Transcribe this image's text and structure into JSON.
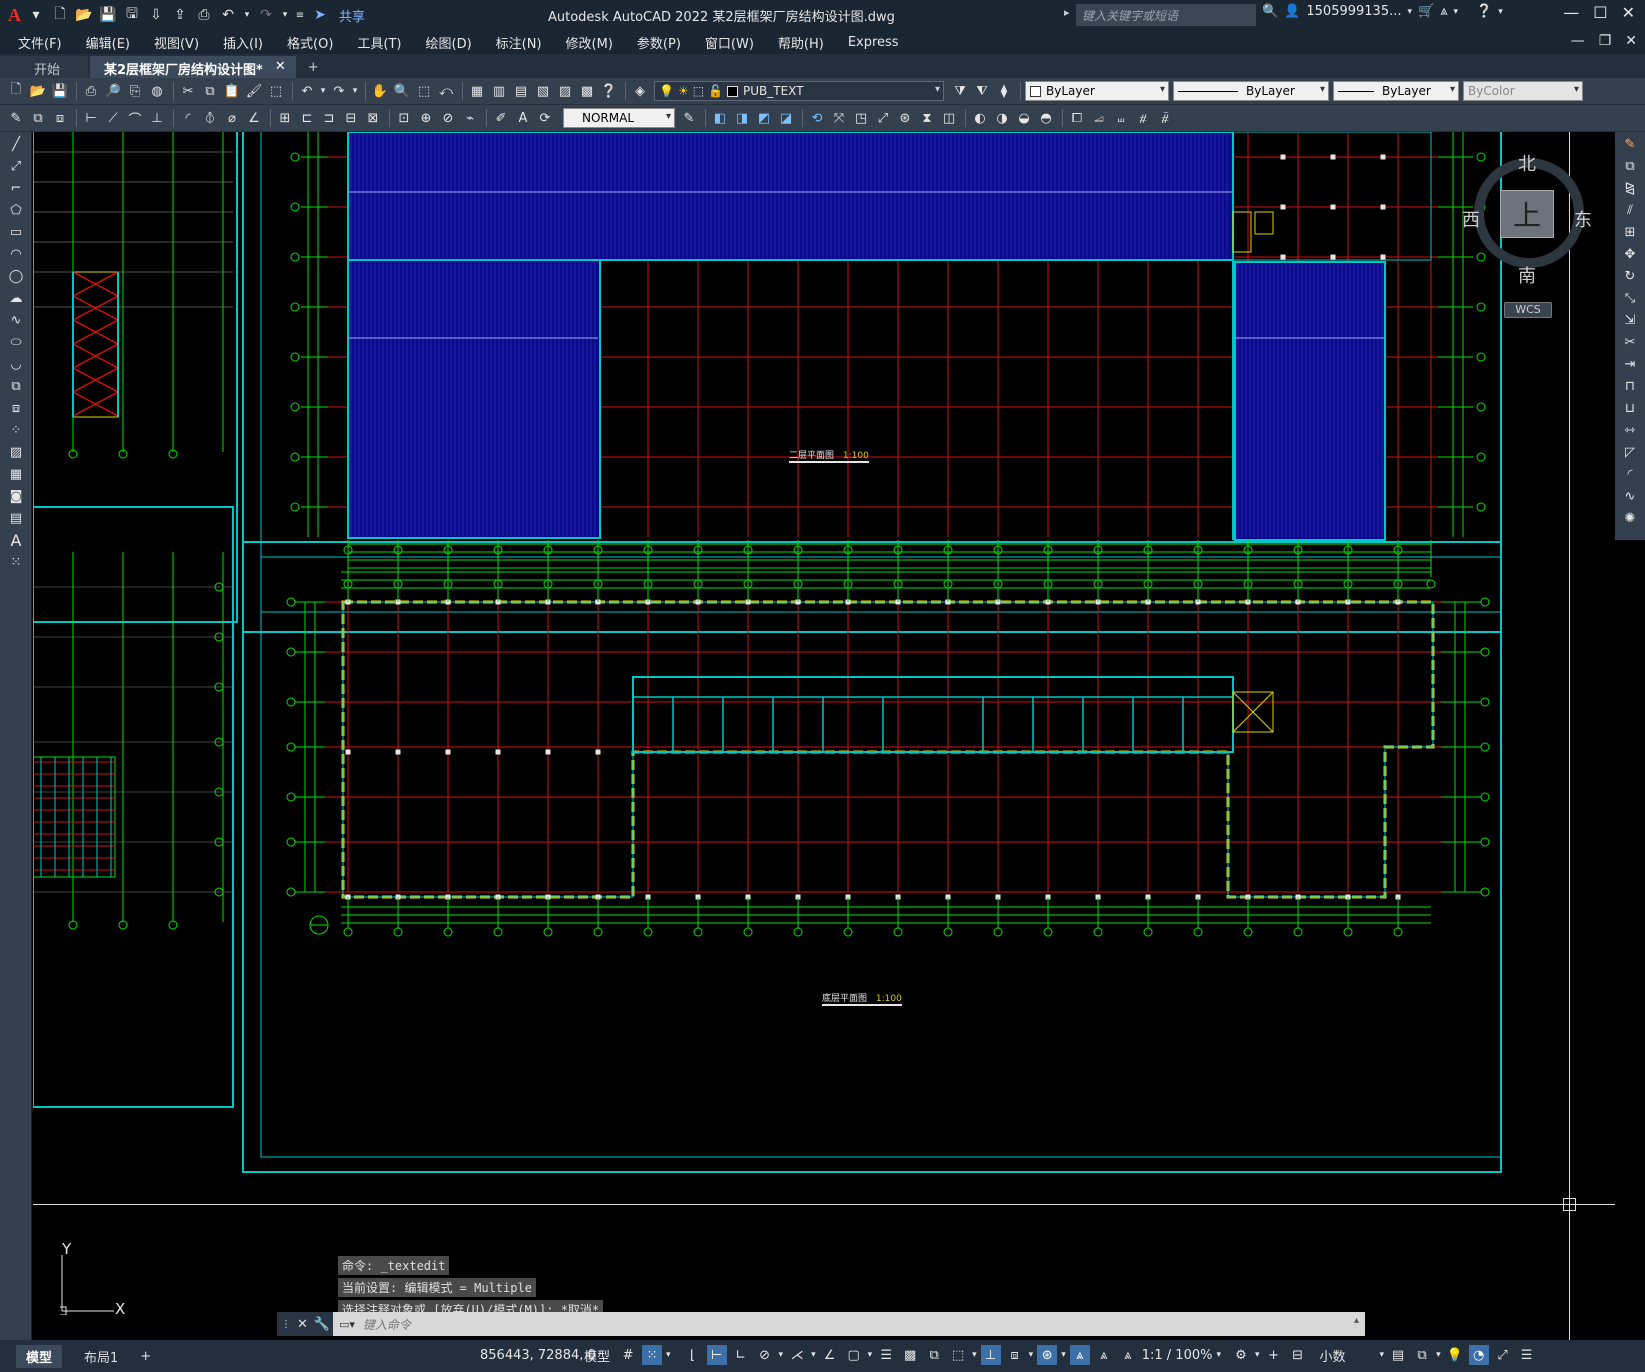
{
  "titlebar": {
    "app_logo": "A",
    "share_label": "共享",
    "title": "Autodesk AutoCAD 2022    某2层框架厂房结构设计图.dwg",
    "search_placeholder": "键入关键字或短语",
    "user": "1505999135...",
    "icons": [
      "new-icon",
      "open-icon",
      "save-icon",
      "saveas-icon",
      "cloud-icon",
      "print-icon",
      "undo-icon",
      "redo-icon",
      "share-icon"
    ]
  },
  "menu": {
    "items": [
      "文件(F)",
      "编辑(E)",
      "视图(V)",
      "插入(I)",
      "格式(O)",
      "工具(T)",
      "绘图(D)",
      "标注(N)",
      "修改(M)",
      "参数(P)",
      "窗口(W)",
      "帮助(H)",
      "Express"
    ]
  },
  "tabs": {
    "start": "开始",
    "active": "某2层框架厂房结构设计图*",
    "close": "✕",
    "add": "+"
  },
  "toolbar1": {
    "layer": "PUB_TEXT",
    "color": "ByLayer",
    "linetype": "ByLayer",
    "lineweight": "ByLayer",
    "plotstyle": "ByColor"
  },
  "toolbar2": {
    "dimstyle": "NORMAL"
  },
  "viewcube": {
    "north": "北",
    "south": "南",
    "east": "东",
    "west": "西",
    "face": "上",
    "wcs": "WCS"
  },
  "drawing": {
    "plan_upper_title": "二层平面图",
    "plan_upper_scale": "1:100",
    "plan_lower_title": "底层平面图",
    "plan_lower_scale": "1:100",
    "colors": {
      "grid_red": "#d01010",
      "green": "#00e000",
      "cyan": "#00c8c8",
      "blue_fill": "#0a0a8a",
      "yellow": "#e0d000",
      "white": "#e6e6e6"
    }
  },
  "command": {
    "history": [
      "命令: _textedit",
      "当前设置: 编辑模式 = Multiple",
      "选择注释对象或 [放弃(U)/模式(M)]: *取消*"
    ],
    "input_placeholder": "键入命令",
    "ucs_x": "X",
    "ucs_y": "Y"
  },
  "statusbar": {
    "tab_model": "模型",
    "tab_layout": "布局1",
    "add": "+",
    "coords": "856443, 72884, 0",
    "space": "模型",
    "scale": "1:1 / 100%",
    "units": "小数"
  }
}
